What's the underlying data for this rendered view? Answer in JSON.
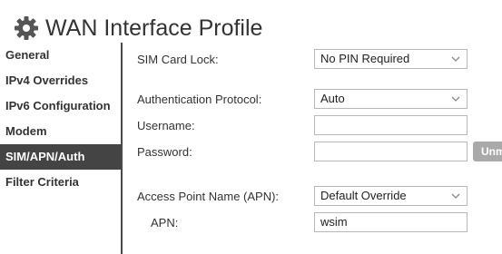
{
  "header": {
    "title": "WAN Interface Profile",
    "icon": "gear-icon"
  },
  "sidebar": {
    "items": [
      {
        "label": "General",
        "active": false
      },
      {
        "label": "IPv4 Overrides",
        "active": false
      },
      {
        "label": "IPv6 Configuration",
        "active": false
      },
      {
        "label": "Modem",
        "active": false
      },
      {
        "label": "SIM/APN/Auth",
        "active": true
      },
      {
        "label": "Filter Criteria",
        "active": false
      }
    ]
  },
  "form": {
    "sim_card_lock": {
      "label": "SIM Card Lock:",
      "value": "No PIN Required"
    },
    "auth_protocol": {
      "label": "Authentication Protocol:",
      "value": "Auto"
    },
    "username": {
      "label": "Username:",
      "value": ""
    },
    "password": {
      "label": "Password:",
      "value": "",
      "unmask_label": "Unmask"
    },
    "apn_source": {
      "label": "Access Point Name (APN):",
      "value": "Default Override"
    },
    "apn": {
      "label": "APN:",
      "value": "wsim"
    }
  },
  "colors": {
    "active_sidebar_bg": "#444444",
    "button_bg": "#a9a9a9",
    "border": "#b8b8b8"
  }
}
